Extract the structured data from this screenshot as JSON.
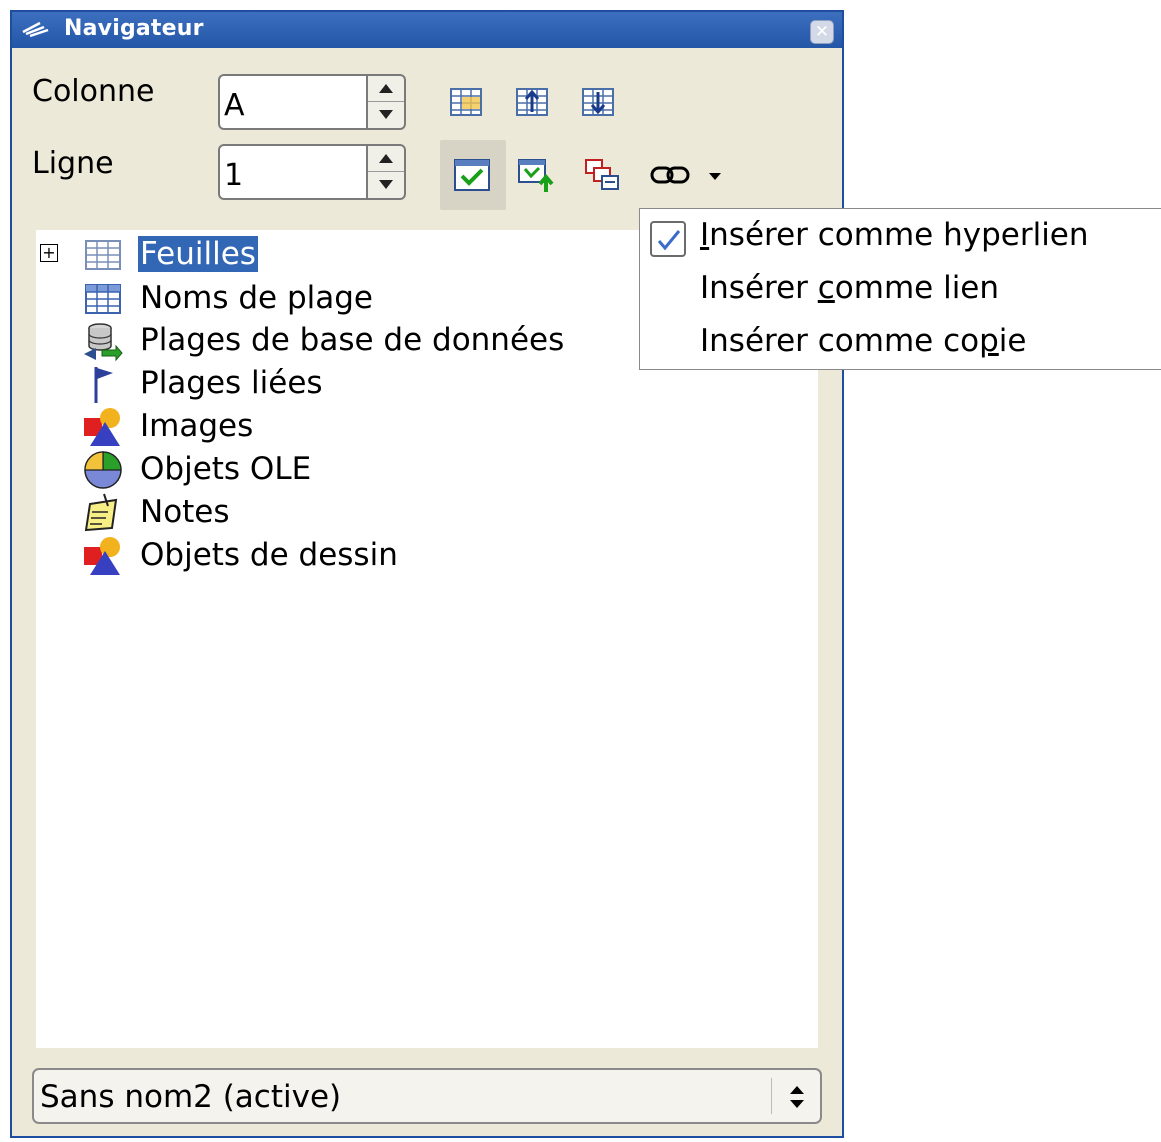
{
  "window": {
    "title": "Navigateur",
    "close_icon": "close-icon"
  },
  "fields": {
    "column": {
      "label": "Colonne",
      "value": "A"
    },
    "row": {
      "label": "Ligne",
      "value": "1"
    }
  },
  "toolbar": {
    "row1": [
      "data-range-icon",
      "start-icon",
      "end-icon"
    ],
    "row2": [
      "content-toggle-icon",
      "scenarios-icon",
      "drag-mode-icon",
      "link-icon",
      "dropdown-arrow-icon"
    ]
  },
  "tree": {
    "items": [
      {
        "label": "Feuilles",
        "icon": "sheet-icon",
        "expandable": true,
        "selected": true
      },
      {
        "label": "Noms de plage",
        "icon": "range-names-icon"
      },
      {
        "label": "Plages de base de données",
        "icon": "database-range-icon"
      },
      {
        "label": "Plages liées",
        "icon": "linked-ranges-flag-icon"
      },
      {
        "label": "Images",
        "icon": "images-icon"
      },
      {
        "label": "Objets OLE",
        "icon": "ole-objects-icon"
      },
      {
        "label": "Notes",
        "icon": "notes-icon"
      },
      {
        "label": "Objets de dessin",
        "icon": "drawing-objects-icon"
      }
    ]
  },
  "document_select": {
    "value": "Sans nom2 (active)"
  },
  "drag_menu": {
    "items": [
      {
        "pre": "",
        "mnemonic": "I",
        "post": "nsérer comme hyperlien",
        "checked": true
      },
      {
        "pre": "Insérer ",
        "mnemonic": "c",
        "post": "omme lien",
        "checked": false
      },
      {
        "pre": "Insérer comme co",
        "mnemonic": "p",
        "post": "ie",
        "checked": false
      }
    ]
  },
  "colors": {
    "title_bar": "#2456a8",
    "selection": "#3267b5",
    "window_bg": "#ece9d8"
  }
}
